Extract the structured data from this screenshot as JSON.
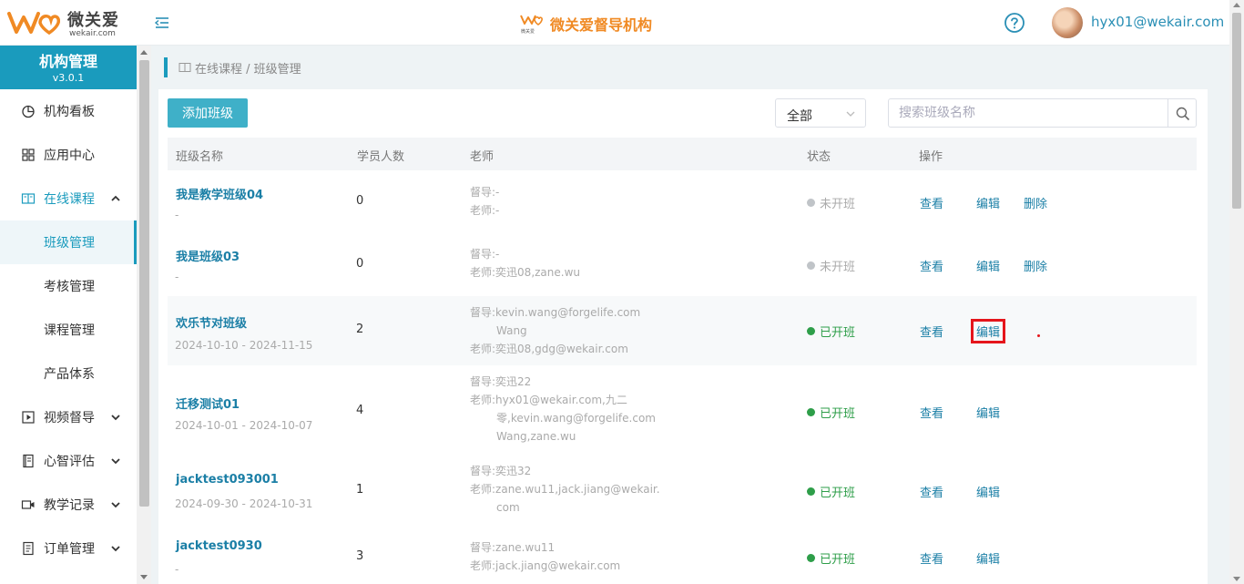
{
  "header": {
    "brand": "微关爱",
    "domain": "wekair.com",
    "center_title": "微关爱督导机构",
    "mini_logo_text": "微关爱",
    "username": "hyx01@wekair.com",
    "icons": [
      "menu-toggle-icon",
      "help-icon"
    ]
  },
  "sidebar": {
    "title": "机构管理",
    "version": "v3.0.1",
    "items": [
      {
        "label": "机构看板",
        "icon": "pie-chart-icon"
      },
      {
        "label": "应用中心",
        "icon": "grid-icon"
      },
      {
        "label": "在线课程",
        "icon": "book-icon",
        "expanded": true
      },
      {
        "label": "班级管理",
        "sub": true,
        "active": true
      },
      {
        "label": "考核管理",
        "sub": true
      },
      {
        "label": "课程管理",
        "sub": true
      },
      {
        "label": "产品体系",
        "sub": true
      },
      {
        "label": "视频督导",
        "icon": "play-icon"
      },
      {
        "label": "心智评估",
        "icon": "notebook-icon"
      },
      {
        "label": "教学记录",
        "icon": "video-icon"
      },
      {
        "label": "订单管理",
        "icon": "receipt-icon"
      }
    ]
  },
  "breadcrumb": "在线课程 / 班级管理",
  "toolbar": {
    "add_label": "添加班级",
    "status_value": "全部",
    "search_placeholder": "搜索班级名称"
  },
  "table": {
    "headers": [
      "班级名称",
      "学员人数",
      "老师",
      "状态",
      "操作"
    ],
    "rows": [
      {
        "name": "我是教学班级04",
        "date": "-",
        "count": "0",
        "supervisor": "督导:-",
        "teacher_lines": [
          "老师:-"
        ],
        "status": "未开班",
        "actions": [
          "查看",
          "编辑",
          "删除"
        ]
      },
      {
        "name": "我是班级03",
        "date": "-",
        "count": "0",
        "supervisor": "督导:-",
        "teacher_lines": [
          "老师:奕迅08,zane.wu"
        ],
        "status": "未开班",
        "actions": [
          "查看",
          "编辑",
          "删除"
        ]
      },
      {
        "name": "欢乐节对班级",
        "date": "2024-10-10 - 2024-11-15",
        "count": "2",
        "supervisor": "督导:kevin.wang@forgelife.com",
        "supervisor_cont": "Wang",
        "teacher_lines": [
          "老师:奕迅08,gdg@wekair.com"
        ],
        "status": "已开班",
        "actions": [
          "查看",
          "编辑"
        ]
      },
      {
        "name": "迁移测试01",
        "date": "2024-10-01 - 2024-10-07",
        "count": "4",
        "supervisor": "督导:奕迅22",
        "teacher_lines": [
          "老师:hyx01@wekair.com,九二",
          "零,kevin.wang@forgelife.com",
          "Wang,zane.wu"
        ],
        "status": "已开班",
        "actions": [
          "查看",
          "编辑"
        ]
      },
      {
        "name": "jacktest093001",
        "date": "2024-09-30 - 2024-10-31",
        "count": "1",
        "supervisor": "督导:奕迅32",
        "teacher_lines": [
          "老师:zane.wu11,jack.jiang@wekair.",
          "com"
        ],
        "status": "已开班",
        "actions": [
          "查看",
          "编辑"
        ]
      },
      {
        "name": "jacktest0930",
        "date": "-",
        "count": "3",
        "supervisor": "督导:zane.wu11",
        "teacher_lines": [
          "老师:jack.jiang@wekair.com"
        ],
        "status": "已开班",
        "actions": [
          "查看",
          "编辑"
        ]
      }
    ]
  },
  "colors": {
    "accent": "#1a9bbd",
    "brand_orange": "#f08a24",
    "link": "#1b7fa6",
    "status_on": "#2e9e49",
    "highlight_box": "#e5151b"
  }
}
